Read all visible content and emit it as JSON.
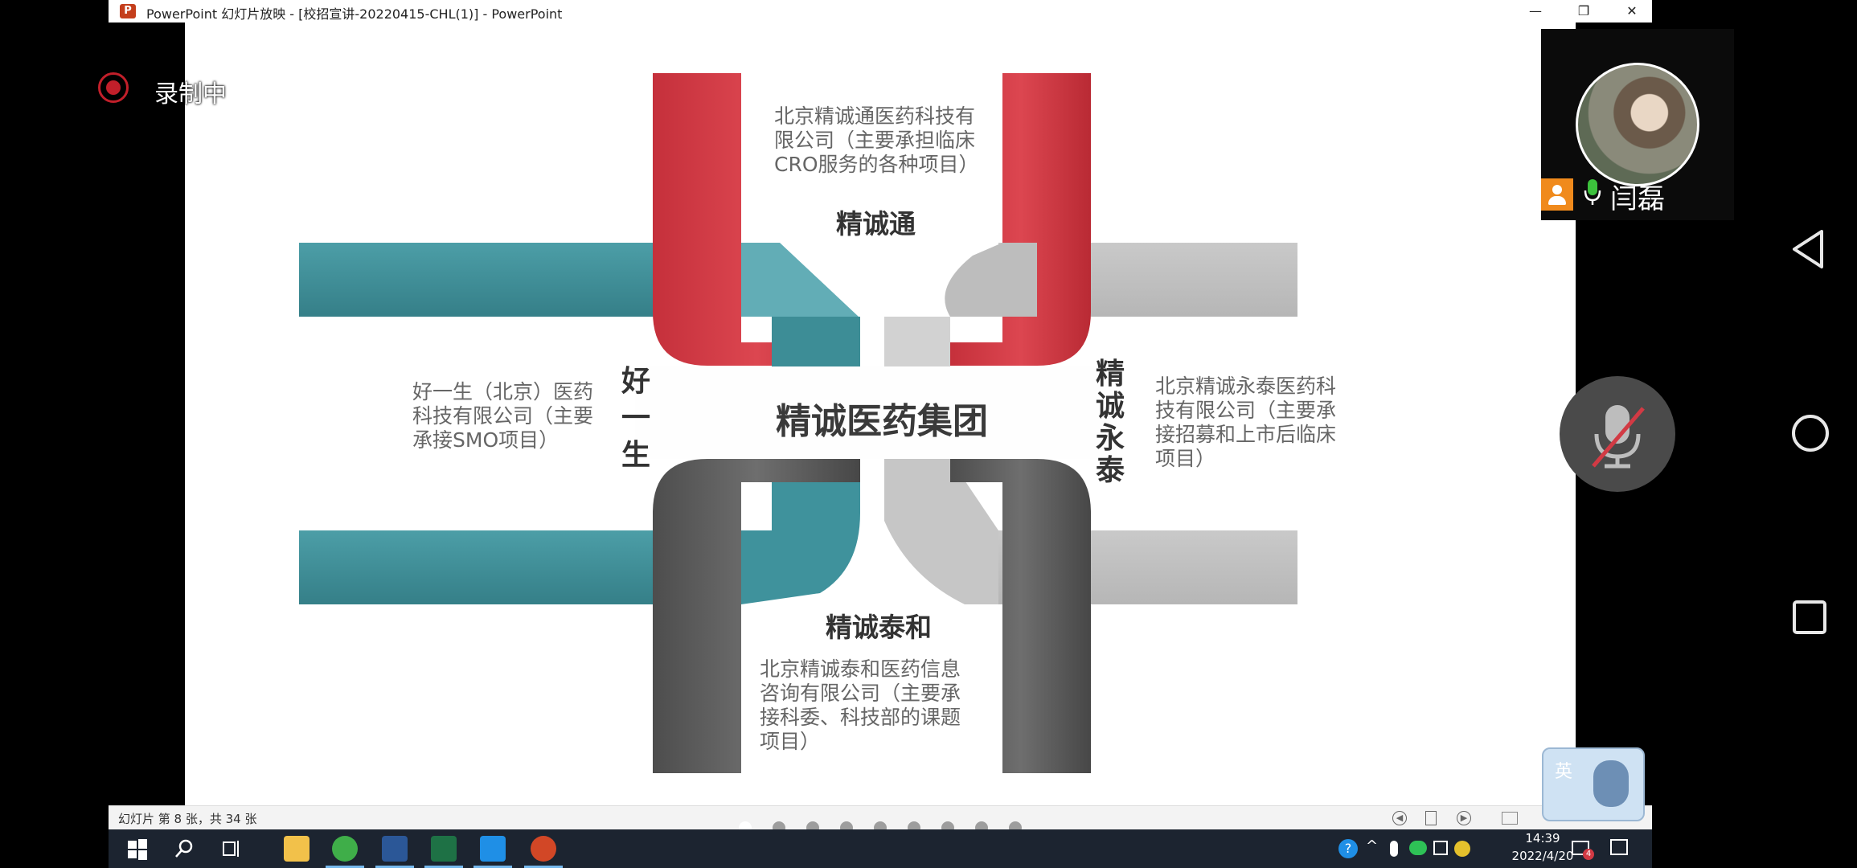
{
  "window": {
    "title": "PowerPoint 幻灯片放映 - [校招宣讲-20220415-CHL(1)] - PowerPoint",
    "app_icon_letter": "P"
  },
  "recording": {
    "label": "录制中",
    "color": "#c21f2a"
  },
  "participant": {
    "name": "闫磊",
    "mic": "active"
  },
  "slide": {
    "center_title": "精诚医药集团",
    "top": {
      "heading": "精诚通",
      "desc_lines": [
        "北京精诚通医药科技有",
        "限公司（主要承担临床",
        "CRO服务的各种项目）"
      ]
    },
    "left": {
      "heading_chars": [
        "好",
        "一",
        "生"
      ],
      "desc_lines": [
        "好一生（北京）医药",
        "科技有限公司（主要",
        "承接SMO项目）"
      ]
    },
    "right": {
      "heading_chars": [
        "精",
        "诚",
        "永",
        "泰"
      ],
      "desc_lines": [
        "北京精诚永泰医药科",
        "技有限公司（主要承",
        "接招募和上市后临床",
        "项目）"
      ]
    },
    "bottom": {
      "heading": "精诚泰和",
      "desc_lines": [
        "北京精诚泰和医药信息",
        "咨询有限公司（主要承",
        "接科委、科技部的课题",
        "项目）"
      ]
    },
    "colors": {
      "red": "#d23a44",
      "teal": "#3f929c",
      "light_gray": "#c3c3c3",
      "dark_gray": "#5b5b5b"
    }
  },
  "statusbar": {
    "slide_info": "幻灯片 第 8 张，共 34 张"
  },
  "taskbar": {
    "apps": [
      "start-icon",
      "search-icon",
      "task-view-icon",
      "file-explorer-icon",
      "browser-icon",
      "word-icon",
      "excel-icon",
      "whiteboard-icon",
      "powerpoint-icon"
    ],
    "time": "14:39",
    "date": "2022/4/20",
    "notification_badge": "4"
  },
  "ime": {
    "label": "英"
  },
  "page_dots": {
    "count": 9,
    "active_index": 0
  }
}
